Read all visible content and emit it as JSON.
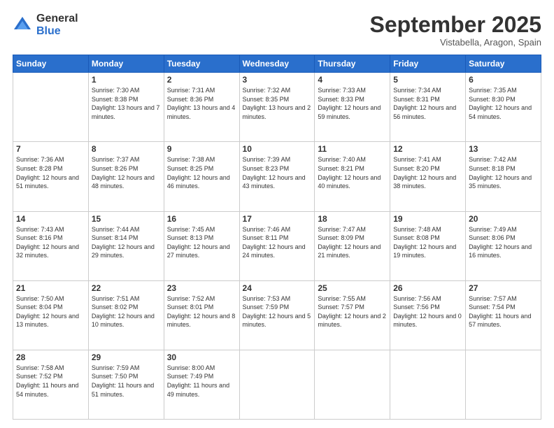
{
  "logo": {
    "general": "General",
    "blue": "Blue"
  },
  "title": "September 2025",
  "subtitle": "Vistabella, Aragon, Spain",
  "days_header": [
    "Sunday",
    "Monday",
    "Tuesday",
    "Wednesday",
    "Thursday",
    "Friday",
    "Saturday"
  ],
  "weeks": [
    [
      {
        "day": "",
        "sunrise": "",
        "sunset": "",
        "daylight": ""
      },
      {
        "day": "1",
        "sunrise": "Sunrise: 7:30 AM",
        "sunset": "Sunset: 8:38 PM",
        "daylight": "Daylight: 13 hours and 7 minutes."
      },
      {
        "day": "2",
        "sunrise": "Sunrise: 7:31 AM",
        "sunset": "Sunset: 8:36 PM",
        "daylight": "Daylight: 13 hours and 4 minutes."
      },
      {
        "day": "3",
        "sunrise": "Sunrise: 7:32 AM",
        "sunset": "Sunset: 8:35 PM",
        "daylight": "Daylight: 13 hours and 2 minutes."
      },
      {
        "day": "4",
        "sunrise": "Sunrise: 7:33 AM",
        "sunset": "Sunset: 8:33 PM",
        "daylight": "Daylight: 12 hours and 59 minutes."
      },
      {
        "day": "5",
        "sunrise": "Sunrise: 7:34 AM",
        "sunset": "Sunset: 8:31 PM",
        "daylight": "Daylight: 12 hours and 56 minutes."
      },
      {
        "day": "6",
        "sunrise": "Sunrise: 7:35 AM",
        "sunset": "Sunset: 8:30 PM",
        "daylight": "Daylight: 12 hours and 54 minutes."
      }
    ],
    [
      {
        "day": "7",
        "sunrise": "Sunrise: 7:36 AM",
        "sunset": "Sunset: 8:28 PM",
        "daylight": "Daylight: 12 hours and 51 minutes."
      },
      {
        "day": "8",
        "sunrise": "Sunrise: 7:37 AM",
        "sunset": "Sunset: 8:26 PM",
        "daylight": "Daylight: 12 hours and 48 minutes."
      },
      {
        "day": "9",
        "sunrise": "Sunrise: 7:38 AM",
        "sunset": "Sunset: 8:25 PM",
        "daylight": "Daylight: 12 hours and 46 minutes."
      },
      {
        "day": "10",
        "sunrise": "Sunrise: 7:39 AM",
        "sunset": "Sunset: 8:23 PM",
        "daylight": "Daylight: 12 hours and 43 minutes."
      },
      {
        "day": "11",
        "sunrise": "Sunrise: 7:40 AM",
        "sunset": "Sunset: 8:21 PM",
        "daylight": "Daylight: 12 hours and 40 minutes."
      },
      {
        "day": "12",
        "sunrise": "Sunrise: 7:41 AM",
        "sunset": "Sunset: 8:20 PM",
        "daylight": "Daylight: 12 hours and 38 minutes."
      },
      {
        "day": "13",
        "sunrise": "Sunrise: 7:42 AM",
        "sunset": "Sunset: 8:18 PM",
        "daylight": "Daylight: 12 hours and 35 minutes."
      }
    ],
    [
      {
        "day": "14",
        "sunrise": "Sunrise: 7:43 AM",
        "sunset": "Sunset: 8:16 PM",
        "daylight": "Daylight: 12 hours and 32 minutes."
      },
      {
        "day": "15",
        "sunrise": "Sunrise: 7:44 AM",
        "sunset": "Sunset: 8:14 PM",
        "daylight": "Daylight: 12 hours and 29 minutes."
      },
      {
        "day": "16",
        "sunrise": "Sunrise: 7:45 AM",
        "sunset": "Sunset: 8:13 PM",
        "daylight": "Daylight: 12 hours and 27 minutes."
      },
      {
        "day": "17",
        "sunrise": "Sunrise: 7:46 AM",
        "sunset": "Sunset: 8:11 PM",
        "daylight": "Daylight: 12 hours and 24 minutes."
      },
      {
        "day": "18",
        "sunrise": "Sunrise: 7:47 AM",
        "sunset": "Sunset: 8:09 PM",
        "daylight": "Daylight: 12 hours and 21 minutes."
      },
      {
        "day": "19",
        "sunrise": "Sunrise: 7:48 AM",
        "sunset": "Sunset: 8:08 PM",
        "daylight": "Daylight: 12 hours and 19 minutes."
      },
      {
        "day": "20",
        "sunrise": "Sunrise: 7:49 AM",
        "sunset": "Sunset: 8:06 PM",
        "daylight": "Daylight: 12 hours and 16 minutes."
      }
    ],
    [
      {
        "day": "21",
        "sunrise": "Sunrise: 7:50 AM",
        "sunset": "Sunset: 8:04 PM",
        "daylight": "Daylight: 12 hours and 13 minutes."
      },
      {
        "day": "22",
        "sunrise": "Sunrise: 7:51 AM",
        "sunset": "Sunset: 8:02 PM",
        "daylight": "Daylight: 12 hours and 10 minutes."
      },
      {
        "day": "23",
        "sunrise": "Sunrise: 7:52 AM",
        "sunset": "Sunset: 8:01 PM",
        "daylight": "Daylight: 12 hours and 8 minutes."
      },
      {
        "day": "24",
        "sunrise": "Sunrise: 7:53 AM",
        "sunset": "Sunset: 7:59 PM",
        "daylight": "Daylight: 12 hours and 5 minutes."
      },
      {
        "day": "25",
        "sunrise": "Sunrise: 7:55 AM",
        "sunset": "Sunset: 7:57 PM",
        "daylight": "Daylight: 12 hours and 2 minutes."
      },
      {
        "day": "26",
        "sunrise": "Sunrise: 7:56 AM",
        "sunset": "Sunset: 7:56 PM",
        "daylight": "Daylight: 12 hours and 0 minutes."
      },
      {
        "day": "27",
        "sunrise": "Sunrise: 7:57 AM",
        "sunset": "Sunset: 7:54 PM",
        "daylight": "Daylight: 11 hours and 57 minutes."
      }
    ],
    [
      {
        "day": "28",
        "sunrise": "Sunrise: 7:58 AM",
        "sunset": "Sunset: 7:52 PM",
        "daylight": "Daylight: 11 hours and 54 minutes."
      },
      {
        "day": "29",
        "sunrise": "Sunrise: 7:59 AM",
        "sunset": "Sunset: 7:50 PM",
        "daylight": "Daylight: 11 hours and 51 minutes."
      },
      {
        "day": "30",
        "sunrise": "Sunrise: 8:00 AM",
        "sunset": "Sunset: 7:49 PM",
        "daylight": "Daylight: 11 hours and 49 minutes."
      },
      {
        "day": "",
        "sunrise": "",
        "sunset": "",
        "daylight": ""
      },
      {
        "day": "",
        "sunrise": "",
        "sunset": "",
        "daylight": ""
      },
      {
        "day": "",
        "sunrise": "",
        "sunset": "",
        "daylight": ""
      },
      {
        "day": "",
        "sunrise": "",
        "sunset": "",
        "daylight": ""
      }
    ]
  ]
}
